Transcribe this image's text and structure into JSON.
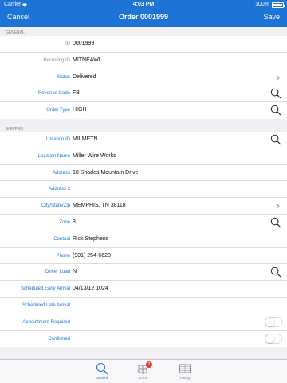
{
  "status_bar": {
    "carrier": "Carrier",
    "time": "4:03 PM",
    "battery": "100%",
    "battery_level": 1.0
  },
  "nav": {
    "cancel": "Cancel",
    "title": "Order 0001999",
    "save": "Save"
  },
  "sections": {
    "general": {
      "header": "GENERAL",
      "rows": [
        {
          "label": "ID",
          "value": "0001999"
        },
        {
          "label": "Recurring ID",
          "value": "MITNEAWI"
        },
        {
          "label": "Status",
          "value": "Delivered"
        },
        {
          "label": "Revenue Code",
          "value": "FB"
        },
        {
          "label": "Order Type",
          "value": "HIGH"
        }
      ]
    },
    "shipper": {
      "header": "SHIPPER",
      "rows": [
        {
          "label": "Location ID",
          "value": "MILMETN"
        },
        {
          "label": "Location Name",
          "value": "Miller Wire Works"
        },
        {
          "label": "Address",
          "value": "18 Shades Mountain Drive"
        },
        {
          "label": "Address 2",
          "value": ""
        },
        {
          "label": "City/State/Zip",
          "value": "MEMPHIS, TN 38118"
        },
        {
          "label": "Zone",
          "value": "3"
        },
        {
          "label": "Contact",
          "value": "Rick Stephens"
        },
        {
          "label": "Phone",
          "value": "(901) 254-6623"
        },
        {
          "label": "Driver Load",
          "value": "N"
        },
        {
          "label": "Scheduled Early Arrival",
          "value": "04/13/12 1024"
        },
        {
          "label": "Scheduled Late Arrival",
          "value": ""
        },
        {
          "label": "Appointment Required",
          "value": ""
        },
        {
          "label": "Confirmed",
          "value": ""
        }
      ]
    }
  },
  "tabs": [
    {
      "label": "General"
    },
    {
      "label": "Stops",
      "badge": "2"
    },
    {
      "label": "Rating"
    }
  ],
  "colors": {
    "accent": "#1d73d6",
    "badge": "#e53935"
  }
}
